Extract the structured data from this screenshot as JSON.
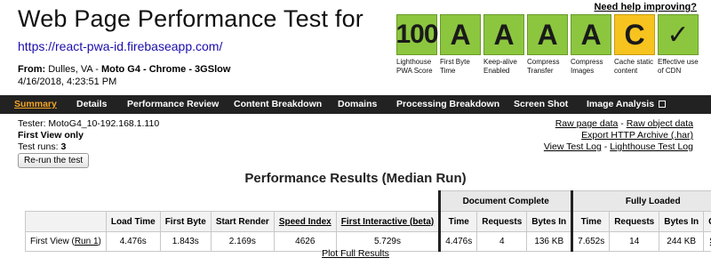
{
  "header": {
    "title": "Web Page Performance Test for",
    "url": "https://react-pwa-id.firebaseapp.com/",
    "from_label": "From:",
    "from_location": "Dulles, VA",
    "from_device": "Moto G4 - Chrome - 3GSlow",
    "date": "4/16/2018, 4:23:51 PM",
    "help_link": "Need help improving?"
  },
  "grades": [
    {
      "value": "100",
      "label": "Lighthouse PWA Score",
      "color": "#8cc63f"
    },
    {
      "value": "A",
      "label": "First Byte Time",
      "color": "#8cc63f"
    },
    {
      "value": "A",
      "label": "Keep-alive Enabled",
      "color": "#8cc63f"
    },
    {
      "value": "A",
      "label": "Compress Transfer",
      "color": "#8cc63f"
    },
    {
      "value": "A",
      "label": "Compress Images",
      "color": "#8cc63f"
    },
    {
      "value": "C",
      "label": "Cache static content",
      "color": "#f7c31e"
    },
    {
      "value": "✓",
      "label": "Effective use of CDN",
      "color": "#8cc63f"
    }
  ],
  "nav": {
    "items": [
      "Summary",
      "Details",
      "Performance Review",
      "Content Breakdown",
      "Domains",
      "Processing Breakdown",
      "Screen Shot",
      "Image Analysis"
    ],
    "active": "Summary"
  },
  "info": {
    "tester": "Tester: MotoG4_10-192.168.1.110",
    "first_view_only": "First View only",
    "test_runs_label": "Test runs:",
    "test_runs_value": "3",
    "rerun_button": "Re-run the test"
  },
  "right_links": {
    "raw_page_data": "Raw page data",
    "raw_object_data": "Raw object data",
    "export_har": "Export HTTP Archive (.har)",
    "view_test_log": "View Test Log",
    "lighthouse_log": "Lighthouse Test Log",
    "sep": " - "
  },
  "results": {
    "title": "Performance Results (Median Run)",
    "group_document_complete": "Document Complete",
    "group_fully_loaded": "Fully Loaded",
    "columns": {
      "load_time": "Load Time",
      "first_byte": "First Byte",
      "start_render": "Start Render",
      "speed_index": "Speed Index",
      "first_interactive": "First Interactive (beta)",
      "dc_time": "Time",
      "dc_requests": "Requests",
      "dc_bytes": "Bytes In",
      "fl_time": "Time",
      "fl_requests": "Requests",
      "fl_bytes": "Bytes In",
      "cost": "Cost"
    },
    "row": {
      "label": "First View (",
      "run_link": "Run 1",
      "label_end": ")",
      "load_time": "4.476s",
      "first_byte": "1.843s",
      "start_render": "2.169s",
      "speed_index": "4626",
      "first_interactive": "5.729s",
      "dc_time": "4.476s",
      "dc_requests": "4",
      "dc_bytes": "136 KB",
      "fl_time": "7.652s",
      "fl_requests": "14",
      "fl_bytes": "244 KB",
      "cost": "$----"
    },
    "plot_link": "Plot Full Results"
  }
}
